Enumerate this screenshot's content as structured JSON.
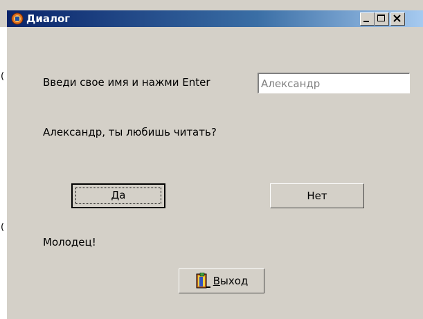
{
  "window": {
    "title": "Диалог",
    "controls": [
      "minimize-icon",
      "maximize-icon",
      "close-icon"
    ]
  },
  "side_glyphs": [
    "(",
    "("
  ],
  "form": {
    "prompt_label": "Введи свое имя и нажми Enter",
    "name_value": "Александр",
    "question": "Александр, ты любишь читать?",
    "response": "Молодец!"
  },
  "buttons": {
    "yes": "Да",
    "no": "Нет",
    "exit_hotkey": "В",
    "exit_rest": "ыход",
    "exit_icon": "exit-door-icon"
  },
  "colors": {
    "titlebar_start": "#0a246a",
    "titlebar_end": "#a6caf0",
    "face": "#d4d0c8"
  }
}
